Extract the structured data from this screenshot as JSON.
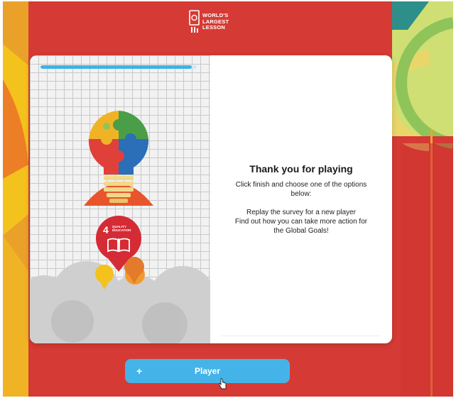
{
  "logo": {
    "text": "WORLD'S\nLARGEST\nLESSON",
    "icon": "book-lightbulb-logo-icon"
  },
  "progress": {
    "fraction": 0.97
  },
  "illustration": {
    "badge_number": "4",
    "badge_text": "QUALITY\nEDUCATION",
    "icon": "puzzle-lightbulb-illustration",
    "badge_icon": "open-book-icon"
  },
  "message": {
    "title": "Thank you for playing",
    "line1": "Click finish and choose one of the options below:",
    "line2": "Replay the survey for a new player",
    "line3": "Find out how you can take more action for the Global Goals!"
  },
  "button": {
    "label": "Player",
    "icon_char": "+",
    "color": "#44b4e8"
  },
  "colors": {
    "background_red": "#d63a34",
    "progress": "#3fb2e6",
    "accent_yellow": "#f4c21c"
  }
}
